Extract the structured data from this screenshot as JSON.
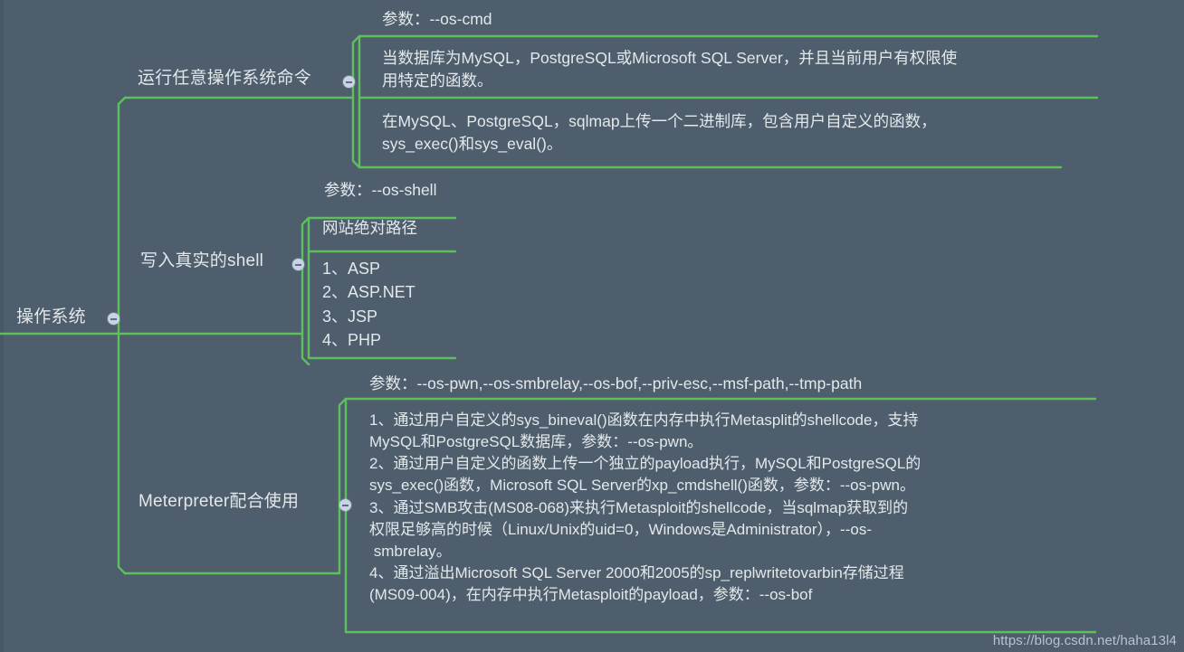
{
  "theme": {
    "background": "#4e5e6d",
    "branch_line": "#5cc05c",
    "text": "#e3e8eb",
    "bullet": "#c8d4e6"
  },
  "root": {
    "label": "操作系统"
  },
  "branches": [
    {
      "label": "运行任意操作系统命令",
      "param": "参数：--os-cmd",
      "blocks": [
        "当数据库为MySQL，PostgreSQL或Microsoft SQL Server，并且当前用户有权限使\n用特定的函数。",
        "在MySQL、PostgreSQL，sqlmap上传一个二进制库，包含用户自定义的函数，\nsys_exec()和sys_eval()。"
      ]
    },
    {
      "label": "写入真实的shell",
      "param": "参数：--os-shell",
      "blocks": [
        "网站绝对路径"
      ],
      "list": [
        "1、ASP",
        "2、ASP.NET",
        "3、JSP",
        "4、PHP"
      ]
    },
    {
      "label": "Meterpreter配合使用",
      "param": "参数：--os-pwn,--os-smbrelay,--os-bof,--priv-esc,--msf-path,--tmp-path",
      "blocks": [
        "1、通过用户自定义的sys_bineval()函数在内存中执行Metasplit的shellcode，支持\nMySQL和PostgreSQL数据库，参数：--os-pwn。\n2、通过用户自定义的函数上传一个独立的payload执行，MySQL和PostgreSQL的\nsys_exec()函数，Microsoft SQL Server的xp_cmdshell()函数，参数：--os-pwn。\n3、通过SMB攻击(MS08-068)来执行Metasploit的shellcode，当sqlmap获取到的\n权限足够高的时候（Linux/Unix的uid=0，Windows是Administrator），--os-\n smbrelay。\n4、通过溢出Microsoft SQL Server 2000和2005的sp_replwritetovarbin存储过程\n(MS09-004)，在内存中执行Metasploit的payload，参数：--os-bof"
      ]
    }
  ],
  "watermark": "https://blog.csdn.net/haha13l4"
}
